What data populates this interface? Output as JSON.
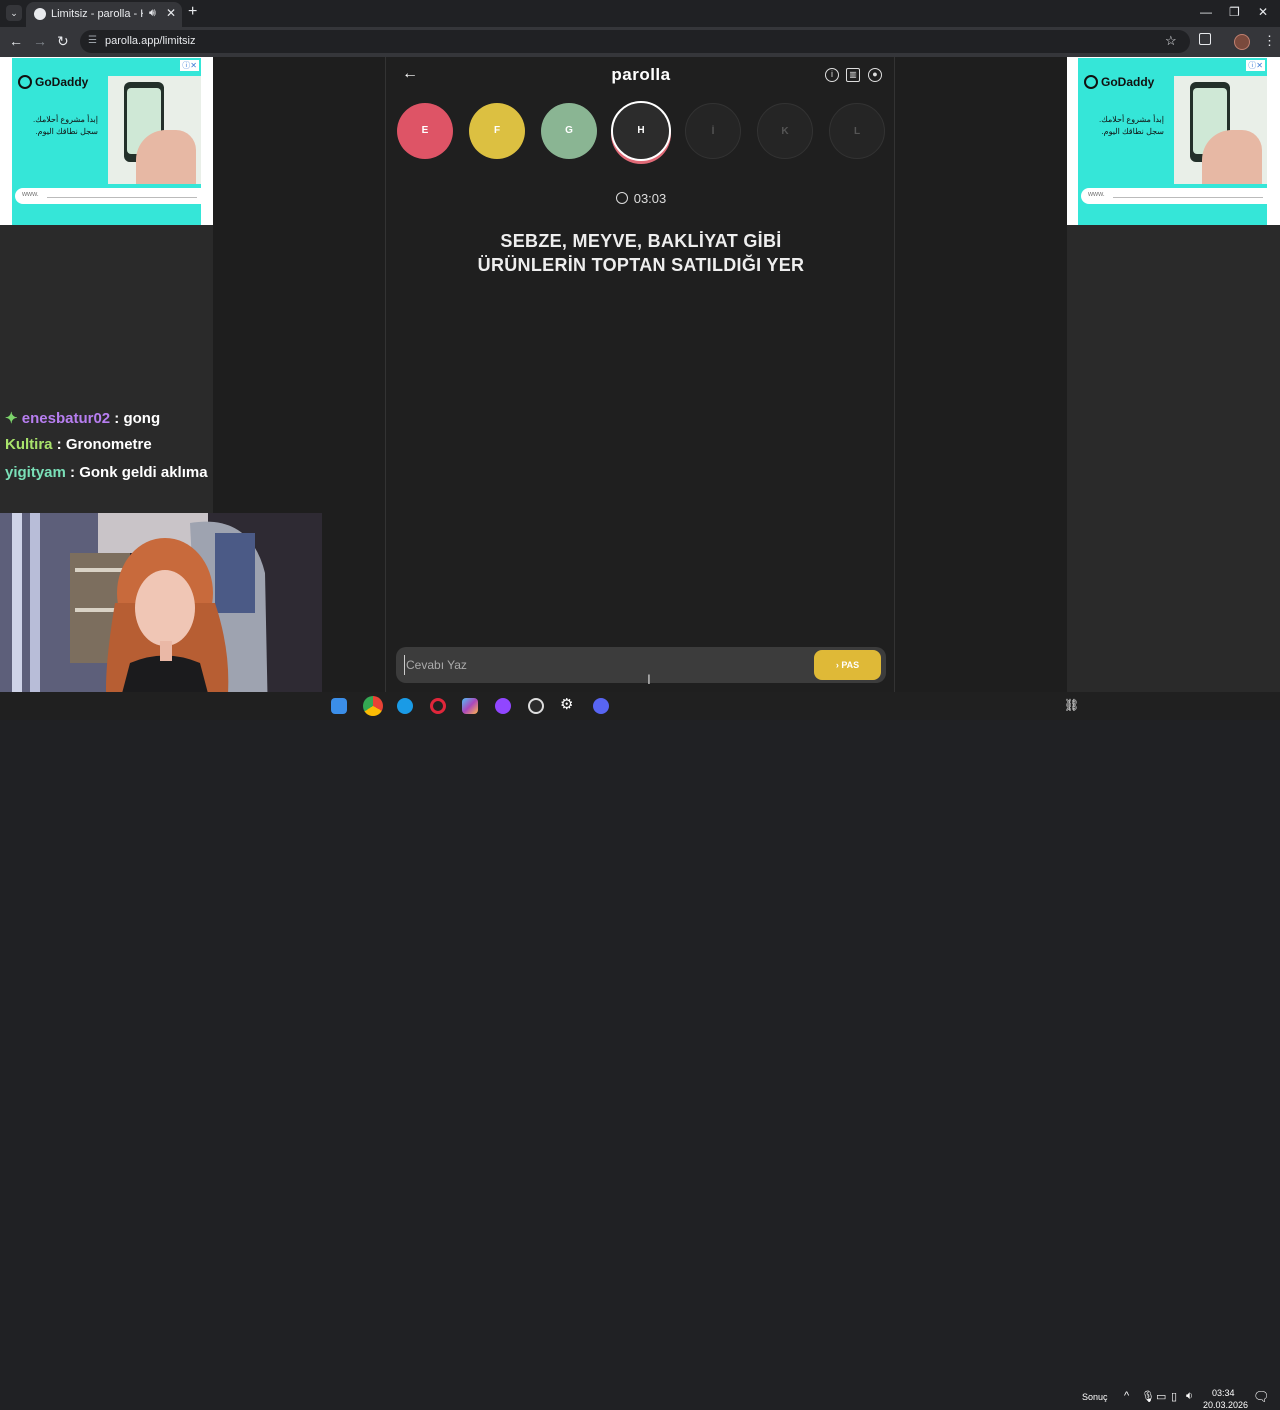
{
  "browser": {
    "tab_title": "Limitsiz - parolla - Kelime oyunu",
    "url": "parolla.app/limitsiz",
    "tab_close": "✕",
    "new_tab": "+",
    "controls": {
      "minimize": "—",
      "restore": "❐",
      "close": "✕"
    }
  },
  "app": {
    "brand": "parolla",
    "letters": [
      {
        "label": "E",
        "color": "#de5466",
        "state": "wrong"
      },
      {
        "label": "F",
        "color": "#dcc041",
        "state": "passed"
      },
      {
        "label": "G",
        "color": "#8ab593",
        "state": "correct"
      },
      {
        "label": "H",
        "color": "#2c2c2c",
        "state": "active"
      },
      {
        "label": "İ",
        "color": "#252525",
        "state": "pending"
      },
      {
        "label": "K",
        "color": "#252525",
        "state": "pending"
      },
      {
        "label": "L",
        "color": "#252525",
        "state": "pending"
      }
    ],
    "timer": "03:03",
    "question_line1": "SEBZE, MEYVE, BAKLİYAT GİBİ",
    "question_line2": "ÜRÜNLERİN TOPTAN SATILDIĞI YER",
    "answer_placeholder": "Cevabı Yaz",
    "pass_button": "› PAS"
  },
  "ads": {
    "brand": "GoDaddy",
    "tagline": "إبدأ مشروع أحلامك. سجل نطاقك اليوم.",
    "field_hint": "www."
  },
  "chat": [
    {
      "user": "enesbatur02",
      "color": "#b77ef0",
      "message": "gong"
    },
    {
      "user": "Kultira",
      "color": "#a8e26b",
      "message": "Gronometre"
    },
    {
      "user": "yigityam",
      "color": "#7ae0b8",
      "message": "Gonk geldi aklıma"
    }
  ],
  "taskbar": {
    "weather": "Sonuç",
    "time": "03:34",
    "date": "20.03.2026"
  }
}
